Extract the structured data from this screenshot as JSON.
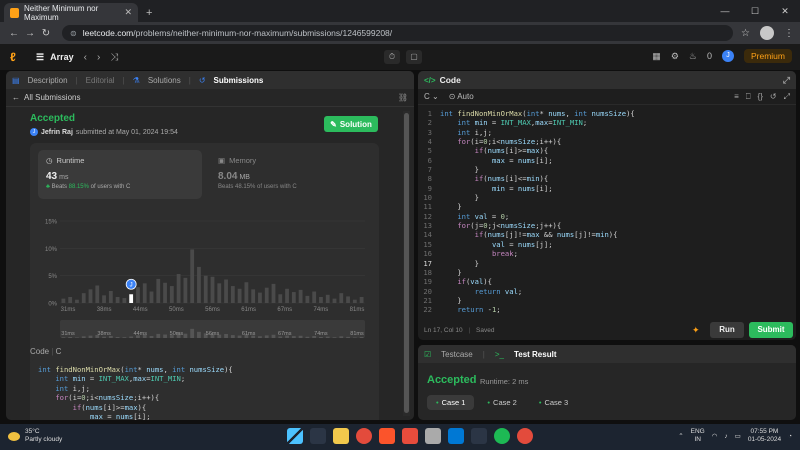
{
  "browser": {
    "tab_title": "Neither Minimum nor Maximum",
    "url_host": "leetcode.com",
    "url_path": "/problems/neither-minimum-nor-maximum/submissions/1246599208/"
  },
  "header": {
    "problem_list": "Array",
    "coins": "0",
    "avatar_letter": "J",
    "premium_label": "Premium"
  },
  "left_tabs": [
    {
      "label": "Description"
    },
    {
      "label": "Editorial"
    },
    {
      "label": "Solutions"
    },
    {
      "label": "Submissions"
    }
  ],
  "back_label": "All Submissions",
  "submission": {
    "status": "Accepted",
    "user": "Jefrin Raj",
    "submitted_text": "submitted at May 01, 2024 19:54",
    "solution_label": "Solution",
    "runtime": {
      "label": "Runtime",
      "value": "43",
      "unit": "ms",
      "beats_prefix": "Beats",
      "beats_pct": "88.15%",
      "beats_suffix": "of users with C"
    },
    "memory": {
      "label": "Memory",
      "value": "8.04",
      "unit": "MB",
      "beats_prefix": "Beats",
      "beats_pct": "48.15%",
      "beats_suffix": "of users with C"
    }
  },
  "chart_data": {
    "type": "bar",
    "ylabel": "",
    "xlabel": "",
    "y_ticks": [
      "15%",
      "10%",
      "5%",
      "0%"
    ],
    "ylim": [
      0,
      15
    ],
    "x_tick_labels": [
      "31ms",
      "38ms",
      "44ms",
      "50ms",
      "56ms",
      "61ms",
      "67ms",
      "74ms",
      "81ms"
    ],
    "values": [
      0.8,
      1.1,
      0.6,
      1.8,
      2.5,
      3.2,
      1.4,
      2.2,
      1.1,
      0.9,
      1.6,
      2.9,
      3.6,
      2.1,
      4.4,
      3.7,
      3.1,
      5.3,
      4.6,
      9.8,
      6.6,
      5.0,
      4.8,
      3.6,
      4.3,
      3.1,
      2.6,
      3.8,
      2.5,
      1.9,
      2.8,
      3.5,
      1.6,
      2.6,
      2.0,
      2.4,
      1.3,
      2.1,
      1.1,
      1.5,
      0.8,
      1.8,
      1.2,
      0.6,
      1.1
    ],
    "highlight_index": 10,
    "marker_label": "J",
    "grid": true
  },
  "code_label": "Code",
  "code_lang": "C",
  "left_code": [
    "int findNonMinOrMax(int* nums, int numsSize){",
    "    int min = INT_MAX,max=INT_MIN;",
    "    int i,j;",
    "    for(i=0;i<numsSize;i++){",
    "        if(nums[i]>=max){",
    "            max = nums[i];"
  ],
  "editor": {
    "title": "Code",
    "language": "C",
    "auto_label": "Auto",
    "lines": [
      "int findNonMinOrMax(int* nums, int numsSize){",
      "    int min = INT_MAX,max=INT_MIN;",
      "    int i,j;",
      "    for(i=0;i<numsSize;i++){",
      "        if(nums[i]>=max){",
      "            max = nums[i];",
      "        }",
      "        if(nums[i]<=min){",
      "            min = nums[i];",
      "        }",
      "    }",
      "    int val = 0;",
      "    for(j=0;j<numsSize;j++){",
      "        if(nums[j]!=max && nums[j]!=min){",
      "            val = nums[j];",
      "            break;",
      "        }",
      "    }",
      "    if(val){",
      "        return val;",
      "    }",
      "    return -1;"
    ],
    "active_line": 17,
    "status": "Ln 17, Col 10",
    "saved": "Saved"
  },
  "actions": {
    "run": "Run",
    "submit": "Submit"
  },
  "results": {
    "testcase_tab": "Testcase",
    "result_tab": "Test Result",
    "status": "Accepted",
    "runtime": "Runtime: 2 ms",
    "cases": [
      "Case 1",
      "Case 2",
      "Case 3"
    ]
  },
  "taskbar": {
    "temp": "35°C",
    "weather": "Partly cloudy",
    "lang1": "ENG",
    "lang2": "IN",
    "time": "07:55 PM",
    "date": "01-05-2024"
  }
}
